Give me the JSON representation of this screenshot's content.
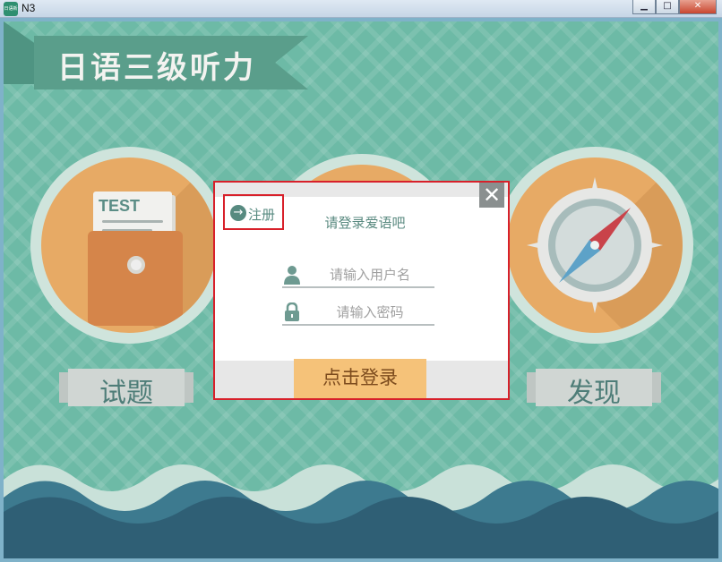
{
  "window": {
    "title": "N3",
    "app_icon_text": "日语新",
    "minimize": "▁",
    "maximize": "□",
    "close": "✕"
  },
  "app": {
    "title": "日语三级听力",
    "test_icon_label": "TEST",
    "banners": {
      "left": "试题",
      "right": "发现"
    }
  },
  "dialog": {
    "close_glyph": "✕",
    "register_label": "注册",
    "title": "请登录爱语吧",
    "username_placeholder": "请输入用户名",
    "password_placeholder": "请输入密码",
    "login_label": "点击登录"
  },
  "colors": {
    "background": "#6dbaa6",
    "circle": "#e7aa65",
    "accent": "#578a80",
    "login_button": "#f5c279",
    "highlight_box": "#d8202a",
    "wave_dark": "#2f5f75"
  }
}
